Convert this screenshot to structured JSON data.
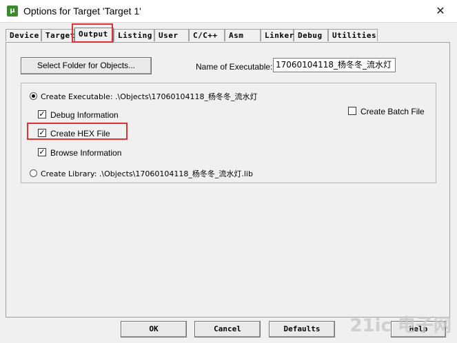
{
  "window": {
    "title": "Options for Target 'Target 1'",
    "icon_text": "μ",
    "close_symbol": "✕"
  },
  "tabs": [
    {
      "label": "Device"
    },
    {
      "label": "Target"
    },
    {
      "label": "Output",
      "active": true
    },
    {
      "label": "Listing"
    },
    {
      "label": "User"
    },
    {
      "label": "C/C++"
    },
    {
      "label": "Asm"
    },
    {
      "label": "Linker"
    },
    {
      "label": "Debug"
    },
    {
      "label": "Utilities"
    }
  ],
  "output": {
    "select_folder_label": "Select Folder for Objects...",
    "name_of_executable_label": "Name of Executable:",
    "name_of_executable_value": "17060104118_杨冬冬_流水灯",
    "create_executable_label": "Create Executable:  .\\Objects\\17060104118_杨冬冬_流水灯",
    "debug_information_label": "Debug Information",
    "create_hex_file_label": "Create HEX File",
    "browse_information_label": "Browse Information",
    "create_batch_file_label": "Create Batch File",
    "create_library_label": "Create Library:  .\\Objects\\17060104118_杨冬冬_流水灯.lib",
    "check_mark": "✓"
  },
  "buttons": {
    "ok": "OK",
    "cancel": "Cancel",
    "defaults": "Defaults",
    "help": "Help"
  },
  "watermark": "21ic 电子网",
  "colors": {
    "highlight": "#e03030"
  }
}
